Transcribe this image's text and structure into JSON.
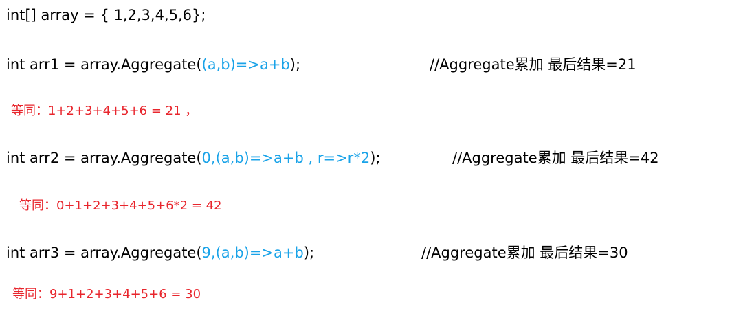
{
  "colors": {
    "code": "#000000",
    "blue": "#1aa3e8",
    "red": "#e8262d"
  },
  "lines": [
    {
      "pre": "int[] array = { 1,2,3,4,5,6};",
      "lambda": "",
      "post": "",
      "comment": ""
    },
    {
      "pre": "int arr1 = array.Aggregate(",
      "lambda": "(a,b)=>a+b",
      "post": ");",
      "comment": "//Aggregate累加 最后结果=21"
    },
    {
      "pre": "int arr2 = array.Aggregate(",
      "lambda": "0,(a,b)=>a+b , r=>r*2",
      "post": ");",
      "comment": "//Aggregate累加 最后结果=42"
    },
    {
      "pre": "int arr3 = array.Aggregate(",
      "lambda": "9,(a,b)=>a+b",
      "post": ");",
      "comment": "//Aggregate累加 最后结果=30"
    }
  ],
  "notes": [
    "等同：1+2+3+4+5+6 = 21 ，",
    "等同：0+1+2+3+4+5+6*2 = 42",
    "等同：9+1+2+3+4+5+6 = 30"
  ]
}
